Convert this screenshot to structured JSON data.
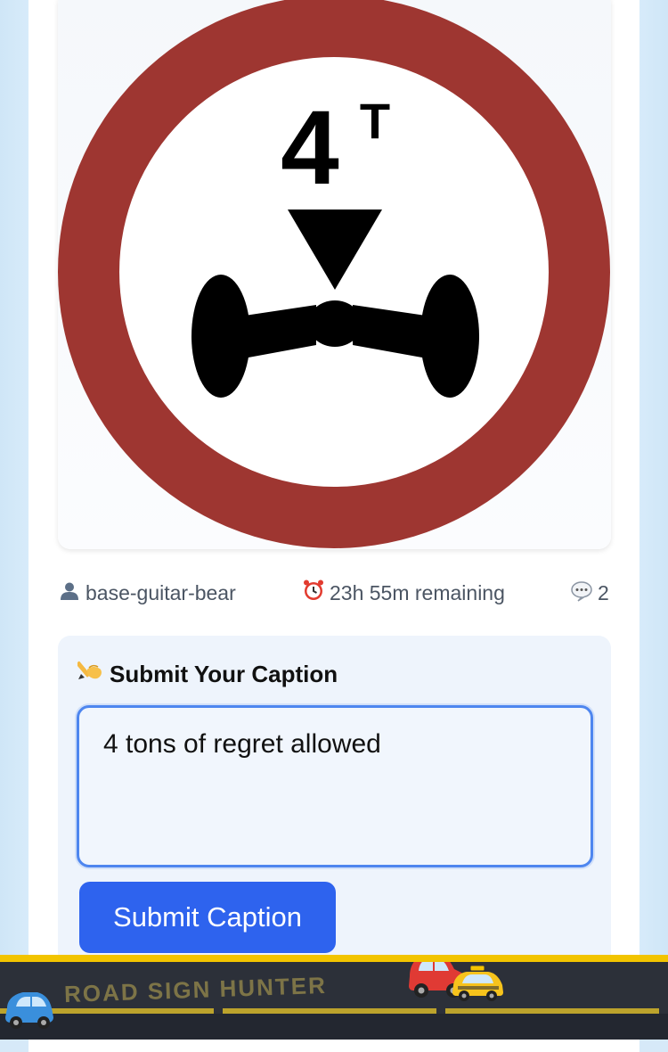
{
  "sign": {
    "weight_number": "4",
    "weight_unit": "T",
    "ring_color": "#9e3631"
  },
  "meta": {
    "user_icon": "user-icon",
    "username": "base-guitar-bear",
    "timer_icon": "alarm-clock-icon",
    "time_remaining": "23h 55m remaining",
    "comments_icon": "speech-bubble-icon",
    "comment_count": "2"
  },
  "caption_form": {
    "title_icon": "writing-hand-icon",
    "title": "Submit Your Caption",
    "input_value": "4 tons of regret allowed",
    "submit_label": "Submit Caption",
    "button_color": "#2e63ee"
  },
  "footer": {
    "brand": "ROAD SIGN HUNTER",
    "accent_color": "#f2c400"
  }
}
